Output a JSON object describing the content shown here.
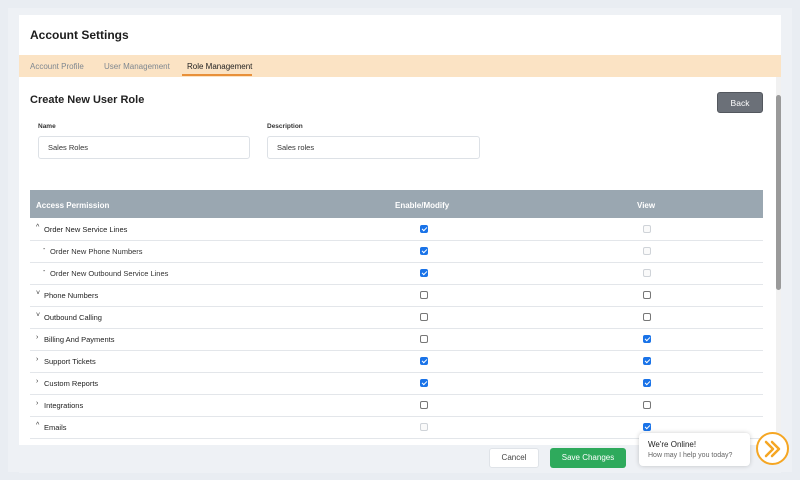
{
  "header": {
    "title": "Account Settings"
  },
  "tabs": [
    {
      "label": "Account Profile"
    },
    {
      "label": "User Management"
    },
    {
      "label": "Role Management"
    }
  ],
  "section": {
    "title": "Create New User Role",
    "back_label": "Back"
  },
  "form": {
    "name_label": "Name",
    "name_value": "Sales Roles",
    "description_label": "Description",
    "description_value": "Sales roles"
  },
  "table": {
    "headers": [
      "Access Permission",
      "Enable/Modify",
      "View"
    ],
    "rows": [
      {
        "label": "Order New Service Lines",
        "chevron": "^",
        "level": 0,
        "enable": "checked",
        "view": "disabled"
      },
      {
        "label": "Order New Phone Numbers",
        "chevron": "-",
        "level": 1,
        "enable": "checked",
        "view": "disabled"
      },
      {
        "label": "Order New Outbound Service Lines",
        "chevron": "-",
        "level": 1,
        "enable": "checked",
        "view": "disabled"
      },
      {
        "label": "Phone Numbers",
        "chevron": "˅",
        "level": 0,
        "enable": "unchecked",
        "view": "unchecked"
      },
      {
        "label": "Outbound Calling",
        "chevron": "˅",
        "level": 0,
        "enable": "unchecked",
        "view": "unchecked"
      },
      {
        "label": "Billing And Payments",
        "chevron": "›",
        "level": 0,
        "enable": "unchecked",
        "view": "checked"
      },
      {
        "label": "Support Tickets",
        "chevron": "›",
        "level": 0,
        "enable": "checked",
        "view": "checked"
      },
      {
        "label": "Custom Reports",
        "chevron": "›",
        "level": 0,
        "enable": "checked",
        "view": "checked"
      },
      {
        "label": "Integrations",
        "chevron": "›",
        "level": 0,
        "enable": "unchecked",
        "view": "unchecked"
      },
      {
        "label": "Emails",
        "chevron": "^",
        "level": 0,
        "enable": "disabled",
        "view": "checked"
      }
    ]
  },
  "footer": {
    "cancel_label": "Cancel",
    "save_label": "Save Changes"
  },
  "chat": {
    "title": "We're Online!",
    "subtitle": "How may I help you today?",
    "icon": "double-chevron-right-icon"
  },
  "colors": {
    "accent": "#e8903a",
    "tab_bar": "#fbe3c4",
    "table_header": "#9aa7b1",
    "save": "#2eaa5c",
    "checkbox": "#1a73e8",
    "chat_ring": "#f5a623"
  }
}
